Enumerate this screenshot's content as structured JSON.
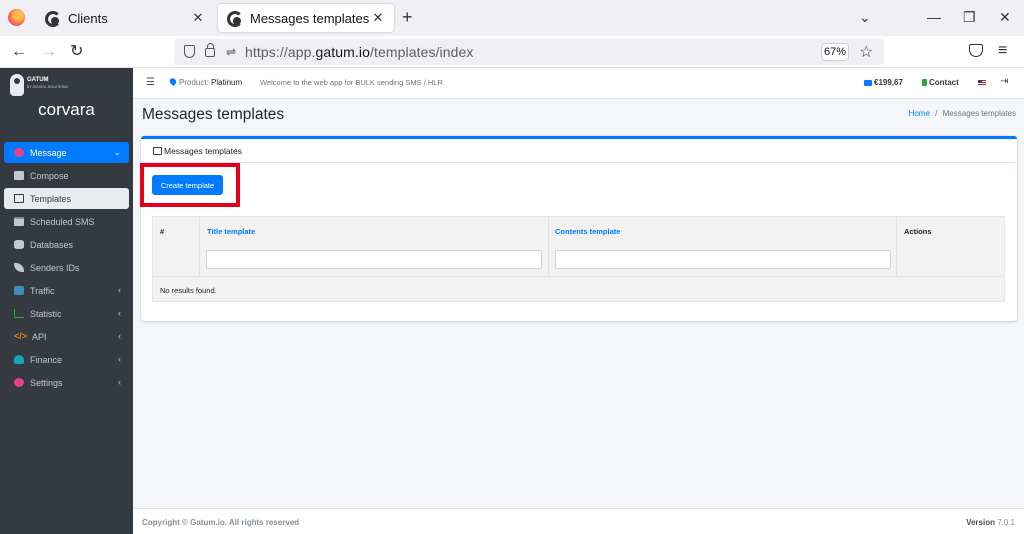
{
  "browser": {
    "tabs": [
      {
        "title": "Clients",
        "active": false
      },
      {
        "title": "Messages templates",
        "active": true
      }
    ],
    "url_prefix": "https://app.",
    "url_domain": "gatum.io",
    "url_suffix": "/templates/index",
    "zoom": "67%"
  },
  "header": {
    "product_label": "Product:",
    "product_value": "Platinum",
    "welcome": "Welcome to the web app for BULK sending SMS / HLR",
    "balance": "€199,67",
    "contact": "Contact"
  },
  "sidebar": {
    "brand_title": "GATUM",
    "brand_subtitle": "BY DIGISOL SOLUTIONS",
    "user_name": "corvara",
    "items": [
      {
        "label": "Message",
        "icon": "message-icon"
      },
      {
        "label": "Compose",
        "icon": "envelope-icon"
      },
      {
        "label": "Templates",
        "icon": "inbox-icon"
      },
      {
        "label": "Scheduled SMS",
        "icon": "calendar-icon"
      },
      {
        "label": "Databases",
        "icon": "database-icon"
      },
      {
        "label": "Senders IDs",
        "icon": "feather-icon"
      },
      {
        "label": "Traffic",
        "icon": "traffic-icon"
      },
      {
        "label": "Statistic",
        "icon": "chart-icon"
      },
      {
        "label": "API",
        "icon": "code-icon"
      },
      {
        "label": "Finance",
        "icon": "finance-icon"
      },
      {
        "label": "Settings",
        "icon": "users-cog-icon"
      }
    ]
  },
  "page": {
    "title": "Messages templates",
    "breadcrumb_home": "Home",
    "breadcrumb_sep": "/",
    "breadcrumb_current": "Messages templates"
  },
  "card": {
    "header": "Messages templates",
    "create_button": "Create template",
    "columns": [
      "#",
      "Title template",
      "Contents template",
      "Actions"
    ],
    "empty_text": "No results found."
  },
  "footer": {
    "copyright": "Copyright © Gatum.io. All rights reserved",
    "version_label": "Version",
    "version_value": "7.0.1"
  },
  "colors": {
    "primary": "#007bff",
    "sidebar": "#343a40",
    "highlight": "#e3001b"
  }
}
